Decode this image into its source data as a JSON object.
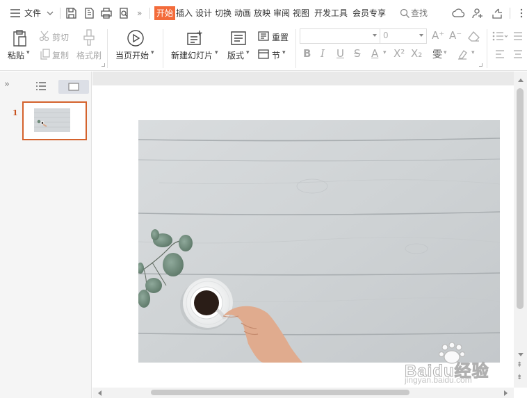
{
  "menu": {
    "menu_label": "文件",
    "tabs": [
      "开始",
      "插入",
      "设计",
      "切换",
      "动画",
      "放映",
      "审阅",
      "视图",
      "开发工具",
      "会员专享"
    ],
    "active_tab": "开始",
    "search_label": "查找",
    "more_glyph": "»"
  },
  "ribbon": {
    "paste": "粘贴",
    "cut": "剪切",
    "copy": "复制",
    "format_painter": "格式刷",
    "start_from_current": "当页开始",
    "new_slide": "新建幻灯片",
    "layout": "版式",
    "reset": "重置",
    "section": "节",
    "font_size_value": "0",
    "font_name_value": ""
  },
  "left_panel": {
    "slide_number": "1",
    "collapse_glyph": "»"
  },
  "watermark": {
    "brand": "Baidu经验",
    "url": "jingyan.baidu.com"
  },
  "colors": {
    "accent": "#f36b3a",
    "thumb_border": "#d4622c",
    "slide_number": "#c8521e"
  }
}
